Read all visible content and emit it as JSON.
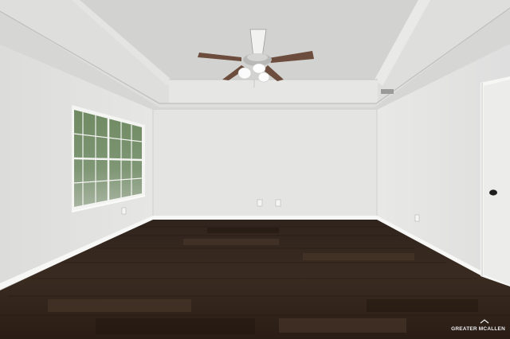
{
  "watermark": {
    "text": "GREATER MCALLEN",
    "icon": "house-roof-icon"
  },
  "colors": {
    "wall": "#e3e3e1",
    "ceiling": "#dcdcda",
    "floor": "#3a2a20",
    "trim": "#ffffff",
    "fan_blade": "#6a4a3a"
  }
}
